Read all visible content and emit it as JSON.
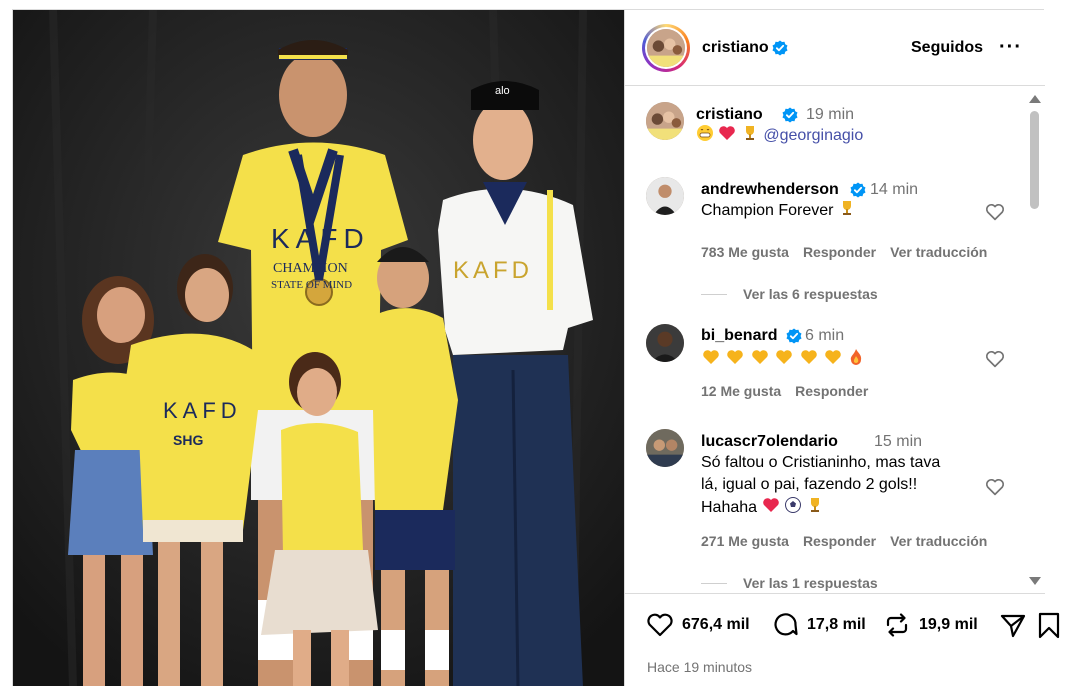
{
  "post": {
    "username": "cristiano",
    "follow_status": "Seguidos",
    "more_label": "···"
  },
  "caption": {
    "username": "cristiano",
    "time": "19 min",
    "mention": "@georginagio"
  },
  "comments": [
    {
      "username": "andrewhenderson",
      "verified": true,
      "time": "14 min",
      "text": "Champion Forever",
      "likes": "783 Me gusta",
      "reply_label": "Responder",
      "translate_label": "Ver traducción",
      "replies_label": "Ver las 6 respuestas"
    },
    {
      "username": "bi_benard",
      "verified": true,
      "time": "6 min",
      "likes": "12 Me gusta",
      "reply_label": "Responder"
    },
    {
      "username": "lucascr7olendario",
      "verified": false,
      "time": "15 min",
      "text_line1": "Só faltou o Cristianinho, mas tava",
      "text_line2": "lá, igual o pai, fazendo 2 gols!!",
      "text_line3": "Hahaha",
      "likes": "271 Me gusta",
      "reply_label": "Responder",
      "translate_label": "Ver traducción",
      "replies_label": "Ver las 1 respuestas"
    }
  ],
  "actions": {
    "likes": "676,4 mil",
    "comments": "17,8 mil",
    "reposts": "19,9 mil",
    "timestamp": "Hace 19 minutos"
  },
  "photo": {
    "jersey_sponsor": "KAFD",
    "sponsor_2": "SHG",
    "slogan_1": "CHAMPION",
    "slogan_2": "STATE OF MIND",
    "cap_logo": "alo"
  },
  "colors": {
    "verified": "#0095f6",
    "link": "#4650a8",
    "jersey_yellow": "#f4e04a",
    "jersey_navy": "#1b2a5c"
  }
}
